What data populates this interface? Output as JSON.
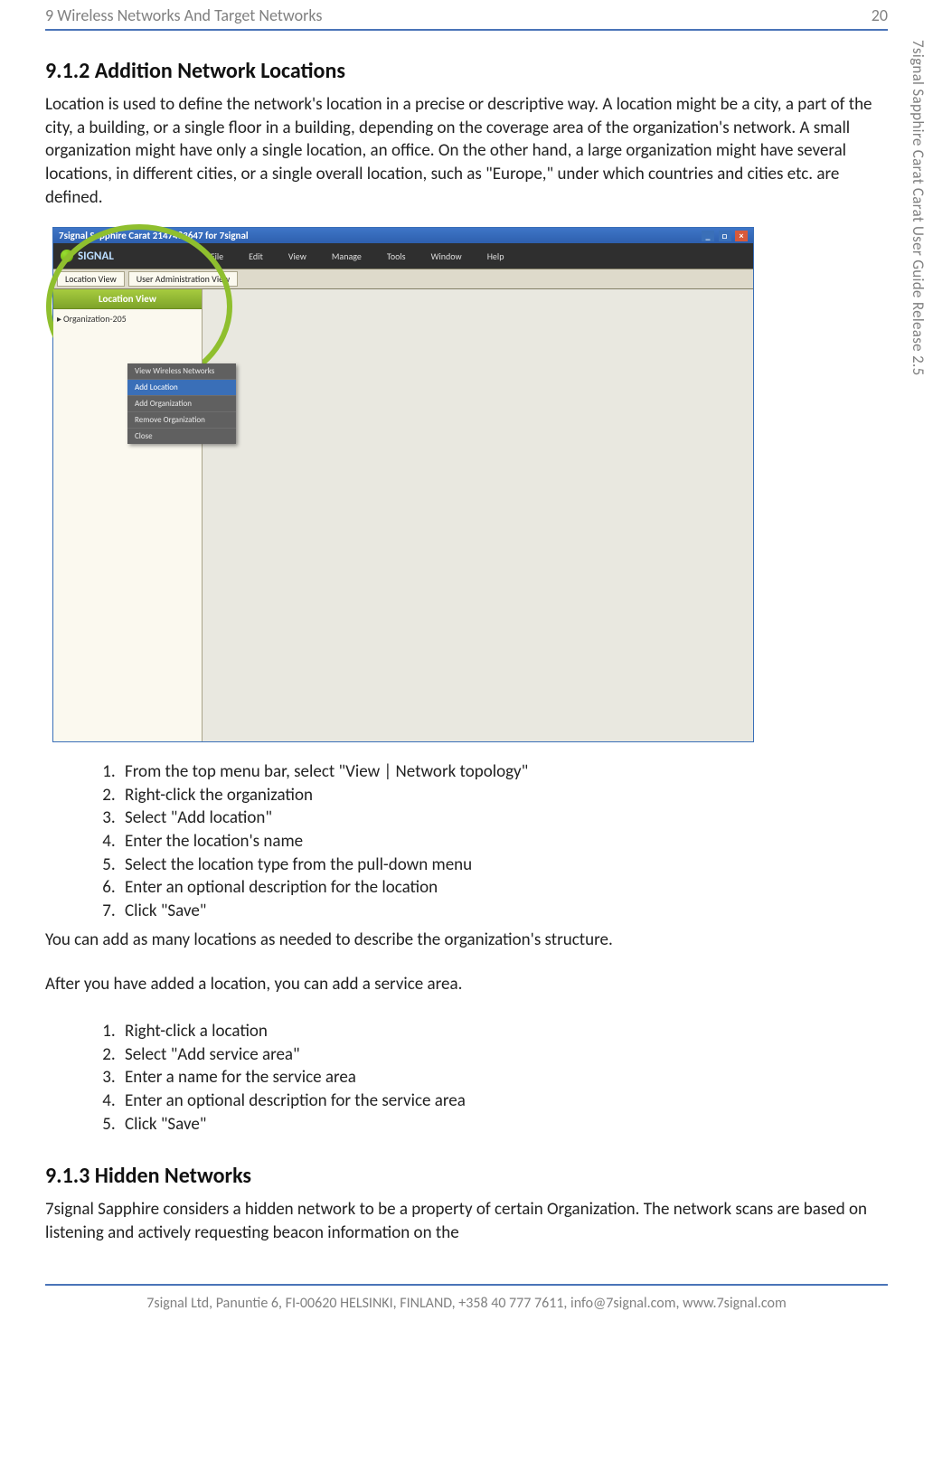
{
  "header": {
    "section_title": "9 Wireless Networks And Target Networks",
    "page_number": "20"
  },
  "side_label": "7signal Sapphire Carat Carat User Guide Release 2.5",
  "sections": {
    "s912": {
      "heading": "9.1.2 Addition Network Locations",
      "para": "Location is used to define the network's location in a precise or descriptive way. A location might be a city, a part of the city, a building, or a single floor in a building, depending on the coverage area of the organization's network. A small organization might have only a single location, an office. On the other hand, a large organization might have several locations, in different cities, or a single overall location, such as \"Europe,\" under which countries and cities etc. are defined.",
      "list1": [
        "From the top menu bar, select \"View | Network topology\"",
        "Right-click the organization",
        "Select \"Add location\"",
        "Enter the location's name",
        "Select the location type from the pull-down menu",
        "Enter an optional description for the location",
        "Click \"Save\""
      ],
      "after_list1a": "You can add as many locations as needed to describe the organization's structure.",
      "after_list1b": "After you have added a location, you can add a service area.",
      "list2": [
        "Right-click a location",
        "Select \"Add service area\"",
        "Enter a name for the service area",
        "Enter an optional description for the service area",
        "Click \"Save\""
      ]
    },
    "s913": {
      "heading": "9.1.3 Hidden Networks",
      "para": "7signal Sapphire considers a hidden network to be a property of certain Organization. The network scans are based on listening and actively requesting beacon information on the"
    }
  },
  "screenshot": {
    "window_title": "7signal Sapphire Carat  2147483647 for 7signal",
    "brand": "SIGNAL",
    "menu": [
      "File",
      "Edit",
      "View",
      "Manage",
      "Tools",
      "Window",
      "Help"
    ],
    "tabs": [
      "Location View",
      "User Administration View"
    ],
    "sidebar_header": "Location View",
    "tree_root": "Organization-205",
    "context_menu": [
      "View Wireless Networks",
      "Add Location",
      "Add Organization",
      "Remove Organization",
      "Close"
    ]
  },
  "footer": "7signal Ltd, Panuntie 6, FI-00620 HELSINKI, FINLAND, +358 40 777 7611, info@7signal.com, www.7signal.com"
}
